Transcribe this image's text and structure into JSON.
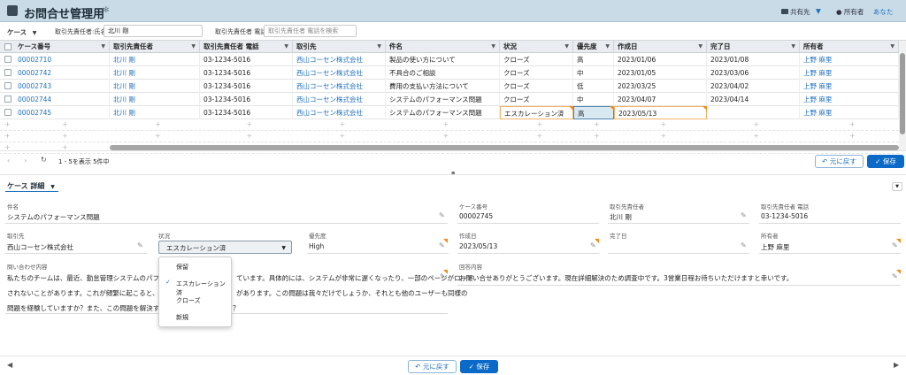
{
  "header": {
    "title": "お問合せ管理用",
    "shared_label": "共有先",
    "owner_label": "所有者",
    "owner_value": "あなた"
  },
  "toolbar": {
    "view_label": "ケース",
    "name_filter_label": "取引先責任者:氏名",
    "name_filter_value": "北川 剛",
    "phone_filter_label": "取引先責任者 電話",
    "phone_filter_placeholder": "取引先責任者 電話を検索"
  },
  "table": {
    "columns": [
      "ケース番号",
      "取引先責任者",
      "取引先責任者 電話",
      "取引先",
      "件名",
      "状況",
      "優先度",
      "作成日",
      "完了日",
      "所有者"
    ],
    "rows": [
      [
        "00002710",
        "北川 剛",
        "03-1234-5016",
        "西山コーセン株式会社",
        "製品の使い方について",
        "クローズ",
        "高",
        "2023/01/06",
        "2023/01/08",
        "上野 麻里"
      ],
      [
        "00002742",
        "北川 剛",
        "03-1234-5016",
        "西山コーセン株式会社",
        "不具合のご相談",
        "クローズ",
        "中",
        "2023/01/05",
        "2023/03/06",
        "上野 麻里"
      ],
      [
        "00002743",
        "北川 剛",
        "03-1234-5016",
        "西山コーセン株式会社",
        "費用の支払い方法について",
        "クローズ",
        "低",
        "2023/03/25",
        "2023/04/02",
        "上野 麻里"
      ],
      [
        "00002744",
        "北川 剛",
        "03-1234-5016",
        "西山コーセン株式会社",
        "システムのパフォーマンス問題",
        "クローズ",
        "中",
        "2023/04/07",
        "2023/04/14",
        "上野 麻里"
      ],
      [
        "00002745",
        "北川 剛",
        "03-1234-5016",
        "西山コーセン株式会社",
        "システムのパフォーマンス問題",
        "エスカレーション済",
        "高",
        "2023/05/13",
        "",
        "上野 麻里"
      ]
    ]
  },
  "pager": {
    "status": "1 - 5を表示 5件中",
    "revert_label": "元に戻す",
    "save_label": "保存"
  },
  "details": {
    "title": "ケース 詳細",
    "subject_label": "件名",
    "subject_value": "システムのパフォーマンス問題",
    "case_no_label": "ケース番号",
    "case_no_value": "00002745",
    "contact_label": "取引先責任者",
    "contact_value": "北川 剛",
    "contact_phone_label": "取引先責任者 電話",
    "contact_phone_value": "03-1234-5016",
    "account_label": "取引先",
    "account_value": "西山コーセン株式会社",
    "status_label": "状況",
    "status_value": "エスカレーション済",
    "priority_label": "優先度",
    "priority_value": "High",
    "created_label": "作成日",
    "created_value": "2023/05/13",
    "closed_label": "完了日",
    "closed_value": "",
    "owner_label": "所有者",
    "owner_value": "上野 麻里",
    "inquiry_label": "問い合わせ内容",
    "inquiry_line1a": "私たちのチームは、最近、勤怠管理システムのパフォー",
    "inquiry_line1b": "ています。具体的には、システムが非常に遅くなったり、一部のページがロード",
    "inquiry_line2a": "されないことがあります。これが頻繁に起こると、我々",
    "inquiry_line2b": "があります。この問題は我々だけでしょうか、それとも他のユーザーも同様の",
    "inquiry_line3a": "問題を経験していますか？また、この問題を解決するた",
    "inquiry_line3b": "？",
    "answer_label": "回答内容",
    "answer_value": "お問い合せありがとうございます。現在詳細解決のため調査中です。3営業日程お待ちいただけますと幸いです。"
  },
  "status_options": [
    "保留",
    "エスカレーション済",
    "クローズ",
    "新規"
  ],
  "bottom": {
    "revert_label": "元に戻す",
    "save_label": "保存"
  }
}
